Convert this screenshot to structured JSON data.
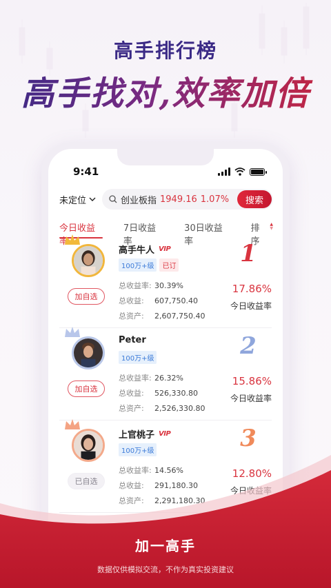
{
  "header": {
    "title": "高手排行榜",
    "slogan": "高手找对,效率加倍"
  },
  "phone": {
    "status": {
      "time": "9:41"
    },
    "location": {
      "label": "未定位"
    },
    "search": {
      "index_name": "创业板指",
      "index_value": "1949.16",
      "index_change": "1.07%",
      "button_label": "搜索"
    },
    "tabs": [
      {
        "label": "今日收益率",
        "active": true
      },
      {
        "label": "7日收益率",
        "active": false
      },
      {
        "label": "30日收益率",
        "active": false
      },
      {
        "label": "排序",
        "active": false
      }
    ],
    "traders": [
      {
        "name": "高手牛人",
        "vip": "VIP",
        "badges": [
          "100万+级",
          "已订"
        ],
        "follow_label": "加自选",
        "stats": [
          {
            "label": "总收益率:",
            "value": "30.39%"
          },
          {
            "label": "总收益:",
            "value": "607,750.40"
          },
          {
            "label": "总资产:",
            "value": "2,607,750.40"
          }
        ],
        "rank": "1",
        "pct": "17.86%",
        "pct_label": "今日收益率",
        "rank_color": "#d9343f"
      },
      {
        "name": "Peter",
        "vip": "",
        "badges": [
          "100万+级"
        ],
        "follow_label": "加自选",
        "stats": [
          {
            "label": "总收益率:",
            "value": "26.32%"
          },
          {
            "label": "总收益:",
            "value": "526,330.80"
          },
          {
            "label": "总资产:",
            "value": "2,526,330.80"
          }
        ],
        "rank": "2",
        "pct": "15.86%",
        "pct_label": "今日收益率",
        "rank_color": "#8fa6dc"
      },
      {
        "name": "上官桃子",
        "vip": "VIP",
        "badges": [
          "100万+级"
        ],
        "follow_label": "已自选",
        "stats": [
          {
            "label": "总收益率:",
            "value": "14.56%"
          },
          {
            "label": "总收益:",
            "value": "291,180.30"
          },
          {
            "label": "总资产:",
            "value": "2,291,180.30"
          }
        ],
        "rank": "3",
        "pct": "12.80%",
        "pct_label": "今日收益率",
        "rank_color": "#f08a5a"
      }
    ]
  },
  "footer": {
    "title": "加一高手",
    "disclaimer": "数据仅供模拟交流，不作为真实投资建议"
  },
  "colors": {
    "accent_red": "#d9343f",
    "brand_purple": "#3b2a86"
  }
}
